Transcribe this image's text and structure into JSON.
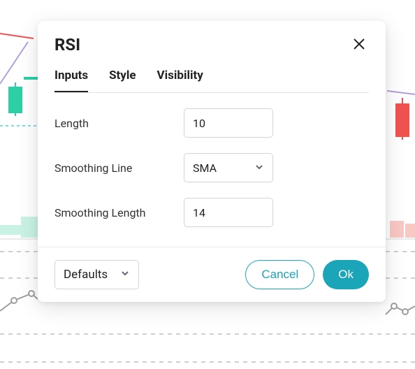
{
  "modal": {
    "title": "RSI",
    "tabs": [
      {
        "label": "Inputs",
        "active": true
      },
      {
        "label": "Style",
        "active": false
      },
      {
        "label": "Visibility",
        "active": false
      }
    ],
    "fields": {
      "length": {
        "label": "Length",
        "value": "10"
      },
      "smoothing_line": {
        "label": "Smoothing Line",
        "value": "SMA"
      },
      "smoothing_length": {
        "label": "Smoothing Length",
        "value": "14"
      }
    },
    "footer": {
      "defaults_label": "Defaults",
      "cancel_label": "Cancel",
      "ok_label": "Ok"
    }
  },
  "colors": {
    "accent": "#1aa5b8",
    "green": "#2dcfa5",
    "red": "#ef5350",
    "purple": "#b39ddb",
    "gray_line": "#9e9e9e",
    "dashed_teal": "#4dd0e1"
  }
}
